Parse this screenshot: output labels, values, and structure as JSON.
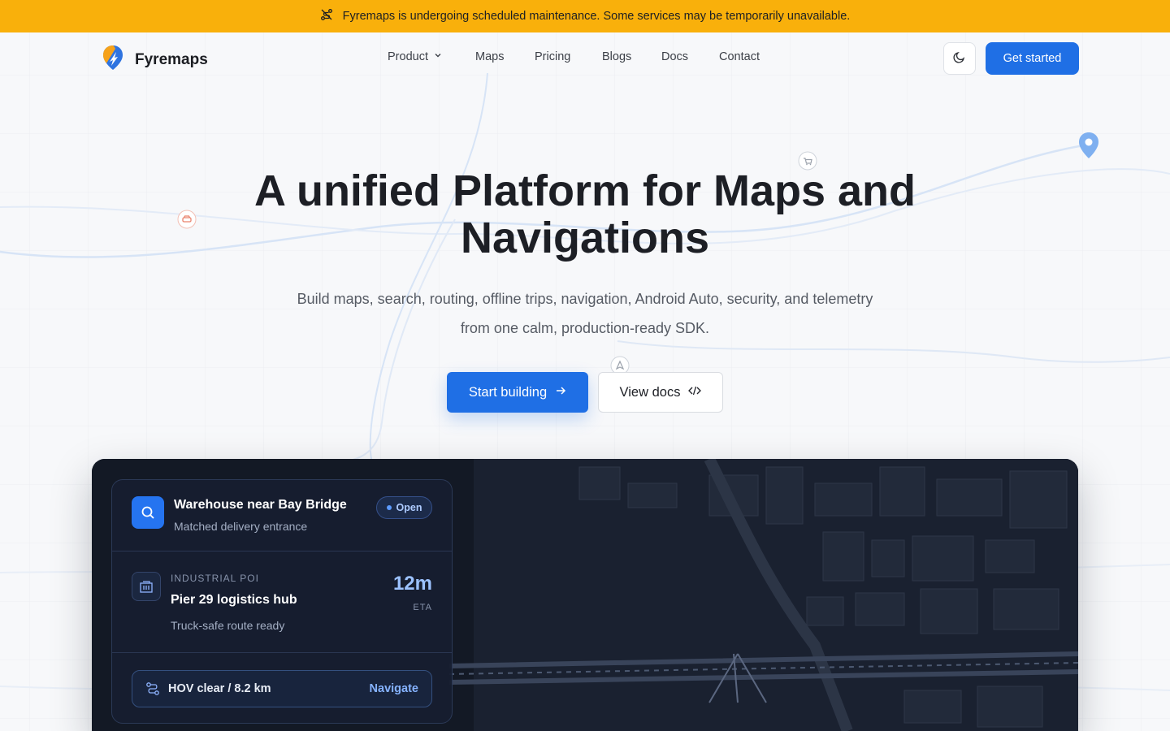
{
  "banner": {
    "icon": "route-off-icon",
    "text": "Fyremaps is undergoing scheduled maintenance. Some services may be temporarily unavailable."
  },
  "header": {
    "logo_text": "Fyremaps",
    "nav": [
      {
        "label": "Product",
        "has_dropdown": true
      },
      {
        "label": "Maps"
      },
      {
        "label": "Pricing"
      },
      {
        "label": "Blogs"
      },
      {
        "label": "Docs"
      },
      {
        "label": "Contact"
      }
    ],
    "theme_toggle_icon": "moon-icon",
    "cta_label": "Get started"
  },
  "hero": {
    "title_line1": "A unified Platform for Maps and",
    "title_line2": "Navigations",
    "subtitle_line1": "Build maps, search, routing, offline trips, navigation, Android Auto, security, and telemetry",
    "subtitle_line2": "from one calm, production-ready SDK.",
    "primary_label": "Start building",
    "secondary_label": "View docs"
  },
  "map_card": {
    "search": {
      "title": "Warehouse near Bay Bridge",
      "subtitle": "Matched delivery entrance",
      "status": "Open"
    },
    "poi": {
      "category": "INDUSTRIAL POI",
      "name": "Pier 29 logistics hub",
      "status": "Truck-safe route ready",
      "eta_value": "12m",
      "eta_label": "ETA"
    },
    "route": {
      "text": "HOV clear / 8.2 km",
      "action": "Navigate"
    }
  },
  "colors": {
    "banner": "#f9b00b",
    "primary": "#1f6fe5",
    "dark_panel": "#141a26"
  }
}
